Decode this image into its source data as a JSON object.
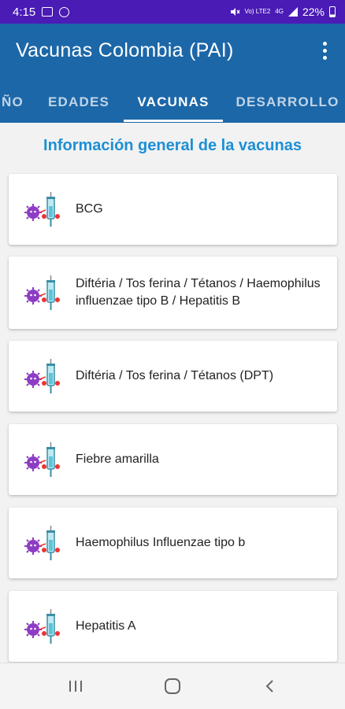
{
  "status_bar": {
    "time": "4:15",
    "network_label": "Vo) LTE2",
    "network_gen": "4G",
    "battery_percent": "22%",
    "icons": [
      "message-icon",
      "at-icon",
      "mute-icon",
      "signal-icon",
      "battery-icon"
    ]
  },
  "app_bar": {
    "title": "Vacunas Colombia (PAI)",
    "menu_icon": "more-vert-icon"
  },
  "tabs": [
    {
      "label": "ÑO",
      "active": false
    },
    {
      "label": "EDADES",
      "active": false
    },
    {
      "label": "VACUNAS",
      "active": true
    },
    {
      "label": "DESARROLLO",
      "active": false
    }
  ],
  "content": {
    "section_title": "Información general de la vacunas",
    "vaccines": [
      {
        "label": "BCG",
        "icon": "vaccine-syringe-icon"
      },
      {
        "label": "Diftéria / Tos ferina / Tétanos / Haemophilus influenzae tipo B / Hepatitis B",
        "icon": "vaccine-syringe-icon"
      },
      {
        "label": "Diftéria / Tos ferina / Tétanos (DPT)",
        "icon": "vaccine-syringe-icon"
      },
      {
        "label": "Fiebre amarilla",
        "icon": "vaccine-syringe-icon"
      },
      {
        "label": "Haemophilus Influenzae tipo b",
        "icon": "vaccine-syringe-icon"
      },
      {
        "label": "Hepatitis A",
        "icon": "vaccine-syringe-icon"
      }
    ]
  },
  "nav_bar": {
    "recents_icon": "recents-icon",
    "home_icon": "home-icon",
    "back_icon": "back-icon"
  },
  "colors": {
    "status_bar": "#4a1bb5",
    "app_bar": "#1c67a8",
    "section_title": "#1c8fd6"
  }
}
